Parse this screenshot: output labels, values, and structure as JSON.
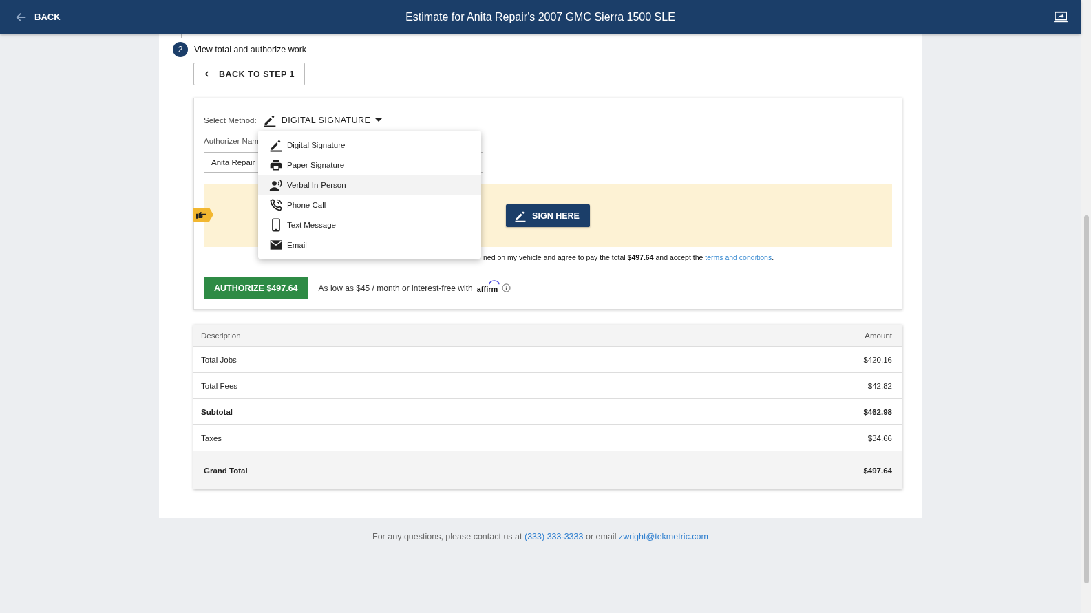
{
  "header": {
    "back_label": "BACK",
    "title": "Estimate for Anita Repair's 2007 GMC Sierra 1500 SLE"
  },
  "step": {
    "number": "2",
    "title": "View total and authorize work",
    "back_button": "BACK TO STEP 1"
  },
  "authorization": {
    "method_label": "Select Method:",
    "method_value": "DIGITAL SIGNATURE",
    "authorizer_label": "Authorizer Nam",
    "authorizer_value": "Anita Repair",
    "sign_button": "SIGN HERE",
    "agreement": "ned on my vehicle and agree to pay the total **$497.64** and accept the",
    "terms_link": "terms and conditions",
    "agreement_end": ".",
    "authorize_button": "AUTHORIZE $497.64",
    "financing_text": "As low as $45 / month or interest-free with",
    "financing_brand": "affirm"
  },
  "method_menu": {
    "items": [
      {
        "label": "Digital Signature",
        "kind": "pen",
        "highlighted": false
      },
      {
        "label": "Paper Signature",
        "kind": "printer",
        "highlighted": false
      },
      {
        "label": "Verbal In-Person",
        "kind": "voice",
        "highlighted": true
      },
      {
        "label": "Phone Call",
        "kind": "phone",
        "highlighted": false
      },
      {
        "label": "Text Message",
        "kind": "mobile",
        "highlighted": false
      },
      {
        "label": "Email",
        "kind": "mail",
        "highlighted": false
      }
    ]
  },
  "summary_table": {
    "columns": [
      "Description",
      "Amount"
    ],
    "rows": [
      {
        "description": "Total Jobs",
        "amount": "$420.16",
        "kind": "normal"
      },
      {
        "description": "Total Fees",
        "amount": "$42.82",
        "kind": "normal"
      },
      {
        "description": "Subtotal",
        "amount": "$462.98",
        "kind": "bold"
      },
      {
        "description": "Taxes",
        "amount": "$34.66",
        "kind": "normal"
      },
      {
        "description": "Grand Total",
        "amount": "$497.64",
        "kind": "total"
      }
    ]
  },
  "footer": {
    "text": "For any questions, please contact us at",
    "phone": "(333) 333-3333",
    "connector": "or email",
    "email": "zwright@tekmetric.com"
  }
}
